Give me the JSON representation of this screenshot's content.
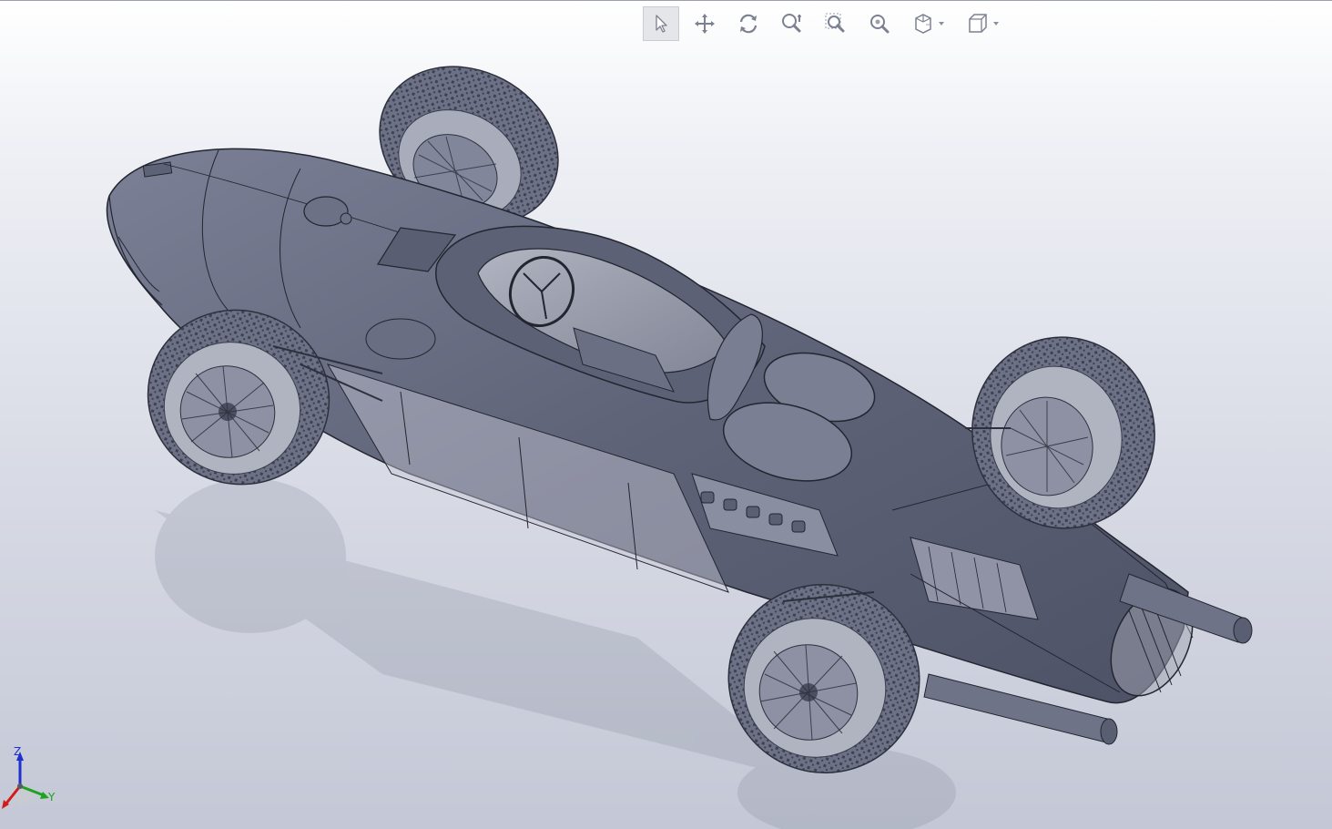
{
  "viewport": {
    "background_top": "#ffffff",
    "background_bottom": "#c4c8d6",
    "model_color": "#6a6e82"
  },
  "heads_up_toolbar": {
    "tools": [
      {
        "icon": "select-arrow-icon",
        "active": true
      },
      {
        "icon": "pan-icon",
        "active": false
      },
      {
        "icon": "rotate-icon",
        "active": false
      },
      {
        "icon": "zoom-to-fit-icon",
        "active": false
      },
      {
        "icon": "zoom-to-area-icon",
        "active": false
      },
      {
        "icon": "zoom-in-out-icon",
        "active": false
      },
      {
        "icon": "view-orientation-icon",
        "active": false,
        "has_dropdown": true
      },
      {
        "icon": "display-style-icon",
        "active": false,
        "has_dropdown": true
      }
    ]
  },
  "triad": {
    "z_label": "Z",
    "y_label": "Y",
    "x_color": "#d21b1b",
    "y_color": "#1ea31e",
    "z_color": "#1f2fd0"
  }
}
